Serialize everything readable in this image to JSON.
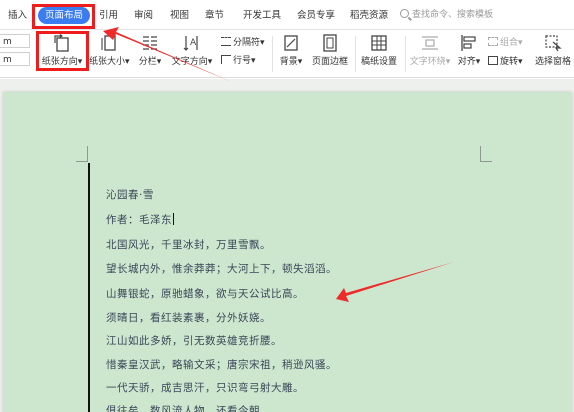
{
  "menu": {
    "tabs": [
      {
        "id": "insert",
        "label": "插入"
      },
      {
        "id": "layout",
        "label": "页面布局"
      },
      {
        "id": "reference",
        "label": "引用"
      },
      {
        "id": "review",
        "label": "审阅"
      },
      {
        "id": "view",
        "label": "视图"
      },
      {
        "id": "section",
        "label": "章节"
      },
      {
        "id": "developer",
        "label": "开发工具"
      },
      {
        "id": "member",
        "label": "会员专享"
      },
      {
        "id": "resources",
        "label": "稻壳资源"
      }
    ],
    "search_text": "查找命令、搜索模板"
  },
  "toolbar": {
    "margin_top": "m",
    "margin_bottom": "m",
    "orientation_label": "纸张方向",
    "size_label": "纸张大小",
    "columns_label": "分栏",
    "text_direction_label": "文字方向",
    "break_label": "分隔符",
    "line_number_label": "行号",
    "background_label": "背景",
    "border_label": "页面边框",
    "manuscript_label": "稿纸设置",
    "wrap_label": "文字环绕",
    "align_label": "对齐",
    "group_label": "组合",
    "rotate_label": "旋转",
    "select_pane_label": "选择窗格",
    "dropdown_arrow": "▾"
  },
  "document": {
    "lines": [
      "沁园春·雪",
      "作者：毛泽东",
      "北国风光，千里冰封，万里雪飘。",
      "望长城内外，惟余莽莽；大河上下，顿失滔滔。",
      "山舞银蛇，原驰蜡象，欲与天公试比高。",
      "须晴日，看红装素裹，分外妖娆。",
      "江山如此多娇，引无数英雄竞折腰。",
      "惜秦皇汉武，略输文采；唐宗宋祖，稍逊风骚。",
      "一代天骄，成吉思汗，只识弯弓射大雕。",
      "俱往矣，数风流人物，还看今朝。"
    ]
  },
  "colors": {
    "accent": "#3b7df0",
    "highlight": "#ee1c1c",
    "page": "#cce7ce"
  }
}
